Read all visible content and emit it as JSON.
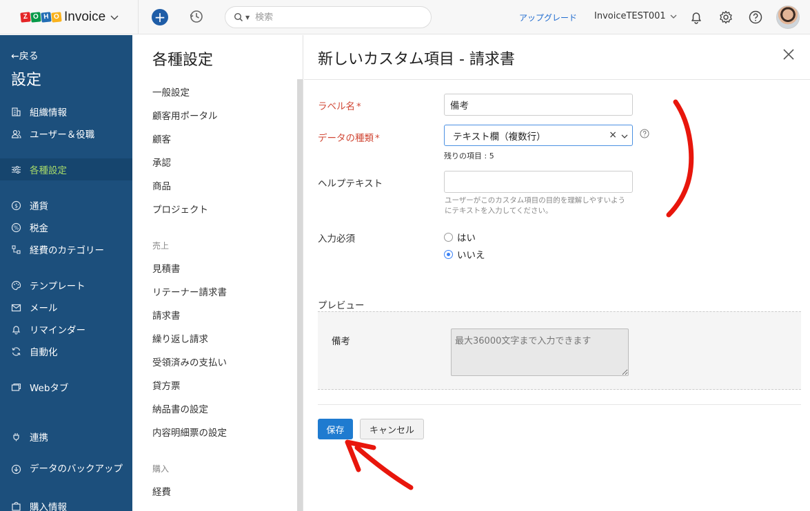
{
  "brand": {
    "logo_letters": [
      "Z",
      "O",
      "H",
      "O"
    ],
    "logo_colors": [
      "#e42527",
      "#089949",
      "#226db4",
      "#f9b21d"
    ],
    "app_name": "Invoice"
  },
  "topbar": {
    "search_placeholder": "検索",
    "upgrade": "アップグレード",
    "org_name": "InvoiceTEST001",
    "icons": [
      "plus-icon",
      "history-icon",
      "search-icon",
      "bell-icon",
      "gear-icon",
      "help-icon"
    ]
  },
  "leftnav": {
    "back": "←戻る",
    "title": "設定",
    "items": [
      {
        "label": "組織情報",
        "icon": "building-icon"
      },
      {
        "label": "ユーザー＆役職",
        "icon": "users-icon"
      },
      {
        "label": "各種設定",
        "icon": "sliders-icon",
        "active": true
      },
      {
        "label": "通貨",
        "icon": "currency-icon"
      },
      {
        "label": "税金",
        "icon": "percent-icon"
      },
      {
        "label": "経費のカテゴリー",
        "icon": "category-icon"
      },
      {
        "label": "テンプレート",
        "icon": "palette-icon"
      },
      {
        "label": "メール",
        "icon": "mail-icon"
      },
      {
        "label": "リマインダー",
        "icon": "bell-icon"
      },
      {
        "label": "自動化",
        "icon": "automation-icon"
      },
      {
        "label": "Webタブ",
        "icon": "webtab-icon"
      },
      {
        "label": "連携",
        "icon": "integration-icon"
      },
      {
        "label": "データのバックアップ",
        "icon": "backup-icon"
      },
      {
        "label": "購入情報",
        "icon": "purchase-icon"
      }
    ],
    "active_color": "#a6d96a",
    "background": "#1c4f7c"
  },
  "settings": {
    "heading": "各種設定",
    "general": [
      "一般設定",
      "顧客用ポータル",
      "顧客",
      "承認",
      "商品",
      "プロジェクト"
    ],
    "sales_group": "売上",
    "sales": [
      "見積書",
      "リテーナー請求書",
      "請求書",
      "繰り返し請求",
      "受領済みの支払い",
      "貸方票",
      "納品書の設定",
      "内容明細票の設定"
    ],
    "purchase_group": "購入",
    "purchase": [
      "経費"
    ]
  },
  "form": {
    "title": "新しいカスタム項目 - 請求書",
    "label_name": {
      "label": "ラベル名",
      "required_mark": "*",
      "value": "備考"
    },
    "data_type": {
      "label": "データの種類",
      "required_mark": "*",
      "value": "テキスト欄（複数行）",
      "clear": "×",
      "remaining": "残りの項目 : 5"
    },
    "help_text": {
      "label": "ヘルプテキスト",
      "value": "",
      "hint": "ユーザーがこのカスタム項目の目的を理解しやすいようにテキストを入力してください。"
    },
    "required": {
      "label": "入力必須",
      "options": [
        "はい",
        "いいえ"
      ],
      "selected": "いいえ"
    },
    "preview": {
      "label": "プレビュー",
      "field_label": "備考",
      "placeholder": "最大36000文字まで入力できます"
    },
    "buttons": {
      "save": "保存",
      "cancel": "キャンセル"
    },
    "required_color": "#d14836",
    "primary_color": "#1f7bd0"
  },
  "annotation_color": "#e8160c"
}
